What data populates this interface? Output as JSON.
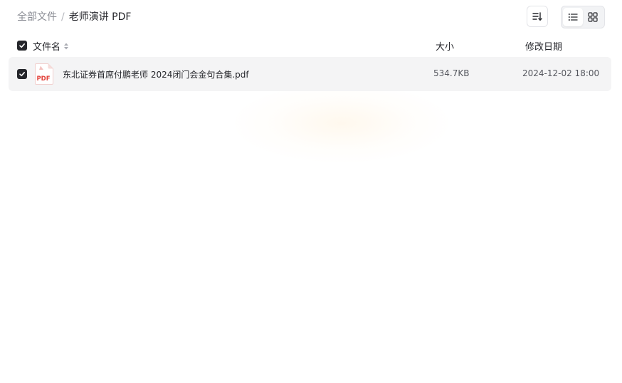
{
  "breadcrumb": {
    "root": "全部文件",
    "separator": "/",
    "current": "老师演讲 PDF"
  },
  "toolbar": {
    "sort_icon": "sort-lines-icon",
    "view_list_icon": "list-view-icon",
    "view_grid_icon": "grid-view-icon",
    "active_view": "list"
  },
  "columns": {
    "name": "文件名",
    "size": "大小",
    "date": "修改日期"
  },
  "files": [
    {
      "icon": "pdf-file-icon",
      "icon_label": "PDF",
      "name": "东北证券首席付鹏老师 2024闭门会金句合集.pdf",
      "size": "534.7KB",
      "modified": "2024-12-02 18:00",
      "checked": true
    }
  ],
  "colors": {
    "text": "#25262b",
    "muted": "#8a8c94",
    "row_bg": "#f4f4f5",
    "pdf_red": "#e2423b",
    "checkbox": "#25262b"
  }
}
